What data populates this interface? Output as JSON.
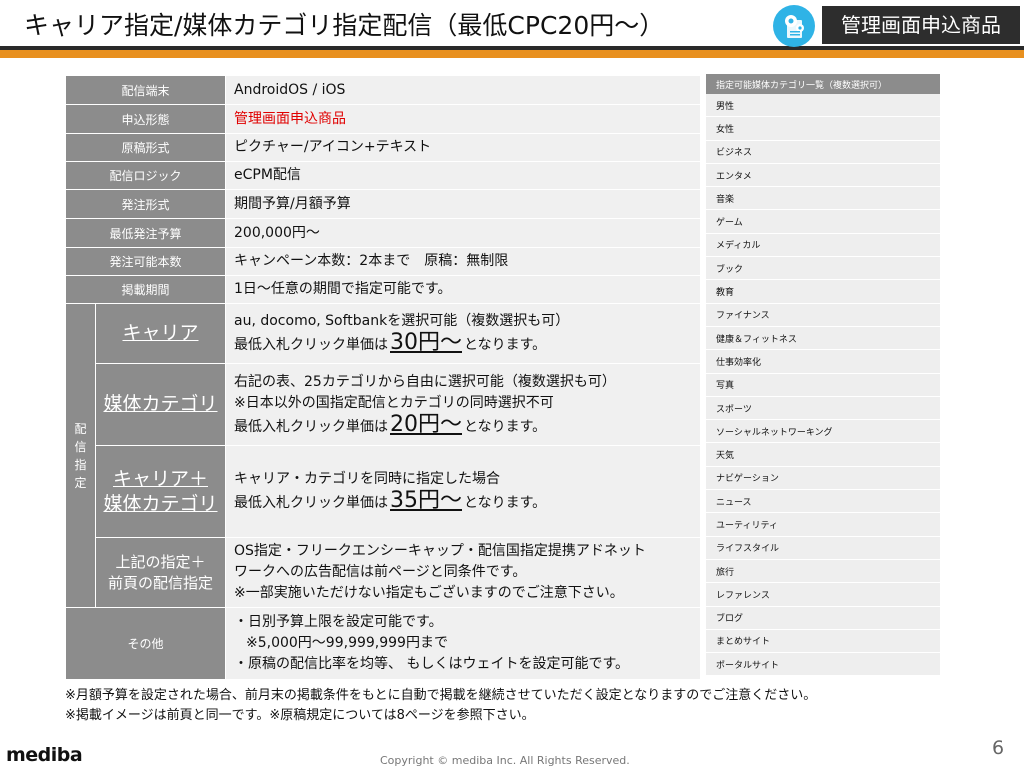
{
  "header": {
    "title": "キャリア指定/媒体カテゴリ指定配信（最低CPC20円～）",
    "badge_icon": "gear-document-icon",
    "badge_label": "管理画面申込商品",
    "colors": {
      "accent": "#e8901f",
      "badge_bg": "#2d2d2d",
      "icon_bg": "#2fb3e6"
    }
  },
  "spec_table": {
    "rows": [
      {
        "label": "配信端末",
        "value": "AndroidOS / iOS"
      },
      {
        "label": "申込形態",
        "value": "管理画面申込商品"
      },
      {
        "label": "原稿形式",
        "value": "ピクチャー/アイコン+テキスト"
      },
      {
        "label": "配信ロジック",
        "value": "eCPM配信"
      },
      {
        "label": "発注形式",
        "value": "期間予算/月額予算"
      },
      {
        "label": "最低発注予算",
        "value": "200,000円～"
      },
      {
        "label": "発注可能本数",
        "value": "キャンペーン本数：2本まで　原稿：無制限"
      },
      {
        "label": "掲載期間",
        "value": "1日～任意の期間で指定可能です。"
      }
    ],
    "targeting_label": "配信指定",
    "targeting": [
      {
        "name": "キャリア",
        "line1": "au, docomo, Softbankを選択可能（複数選択も可）",
        "price_prefix": "最低入札クリック単価は",
        "price": "30円～",
        "price_suffix": "となります。"
      },
      {
        "name": "媒体カテゴリ",
        "line1": "右記の表、25カテゴリから自由に選択可能（複数選択も可）",
        "line2": "※日本以外の国指定配信とカテゴリの同時選択不可",
        "price_prefix": "最低入札クリック単価は",
        "price": "20円～",
        "price_suffix": "となります。"
      },
      {
        "name_line1": "キャリア＋",
        "name_line2": "媒体カテゴリ",
        "line1": "キャリア・カテゴリを同時に指定した場合",
        "price_prefix": "最低入札クリック単価は",
        "price": "35円～",
        "price_suffix": "となります。"
      },
      {
        "name_line1": "上記の指定＋",
        "name_line2": "前頁の配信指定",
        "line1": "OS指定・フリークエンシーキャップ・配信国指定提携アドネット",
        "line2": "ワークへの広告配信は前ページと同条件です。",
        "line3": "※一部実施いただけない指定もございますのでご注意下さい。"
      }
    ],
    "other": {
      "label": "その他",
      "line1": "・日別予算上限を設定可能です。",
      "line2": "※5,000円～99,999,999円まで",
      "line3": "・原稿の配信比率を均等、 もしくはウェイトを設定可能です。"
    }
  },
  "category_table": {
    "header": "指定可能媒体カテゴリ一覧（複数選択可）",
    "items": [
      "男性",
      "女性",
      "ビジネス",
      "エンタメ",
      "音楽",
      "ゲーム",
      "メディカル",
      "ブック",
      "教育",
      "ファイナンス",
      "健康＆フィットネス",
      "仕事効率化",
      "写真",
      "スポーツ",
      "ソーシャルネットワーキング",
      "天気",
      "ナビゲーション",
      "ニュース",
      "ユーティリティ",
      "ライフスタイル",
      "旅行",
      "レファレンス",
      "ブログ",
      "まとめサイト",
      "ポータルサイト"
    ]
  },
  "notes": [
    "※月額予算を設定された場合、前月末の掲載条件をもとに自動で掲載を継続させていただく設定となりますのでご注意ください。",
    "※掲載イメージは前頁と同一です。※原稿規定については8ページを参照下さい。"
  ],
  "footer": {
    "logo": "mediba",
    "copyright": "Copyright © mediba Inc. All Rights Reserved.",
    "page_number": "6"
  }
}
